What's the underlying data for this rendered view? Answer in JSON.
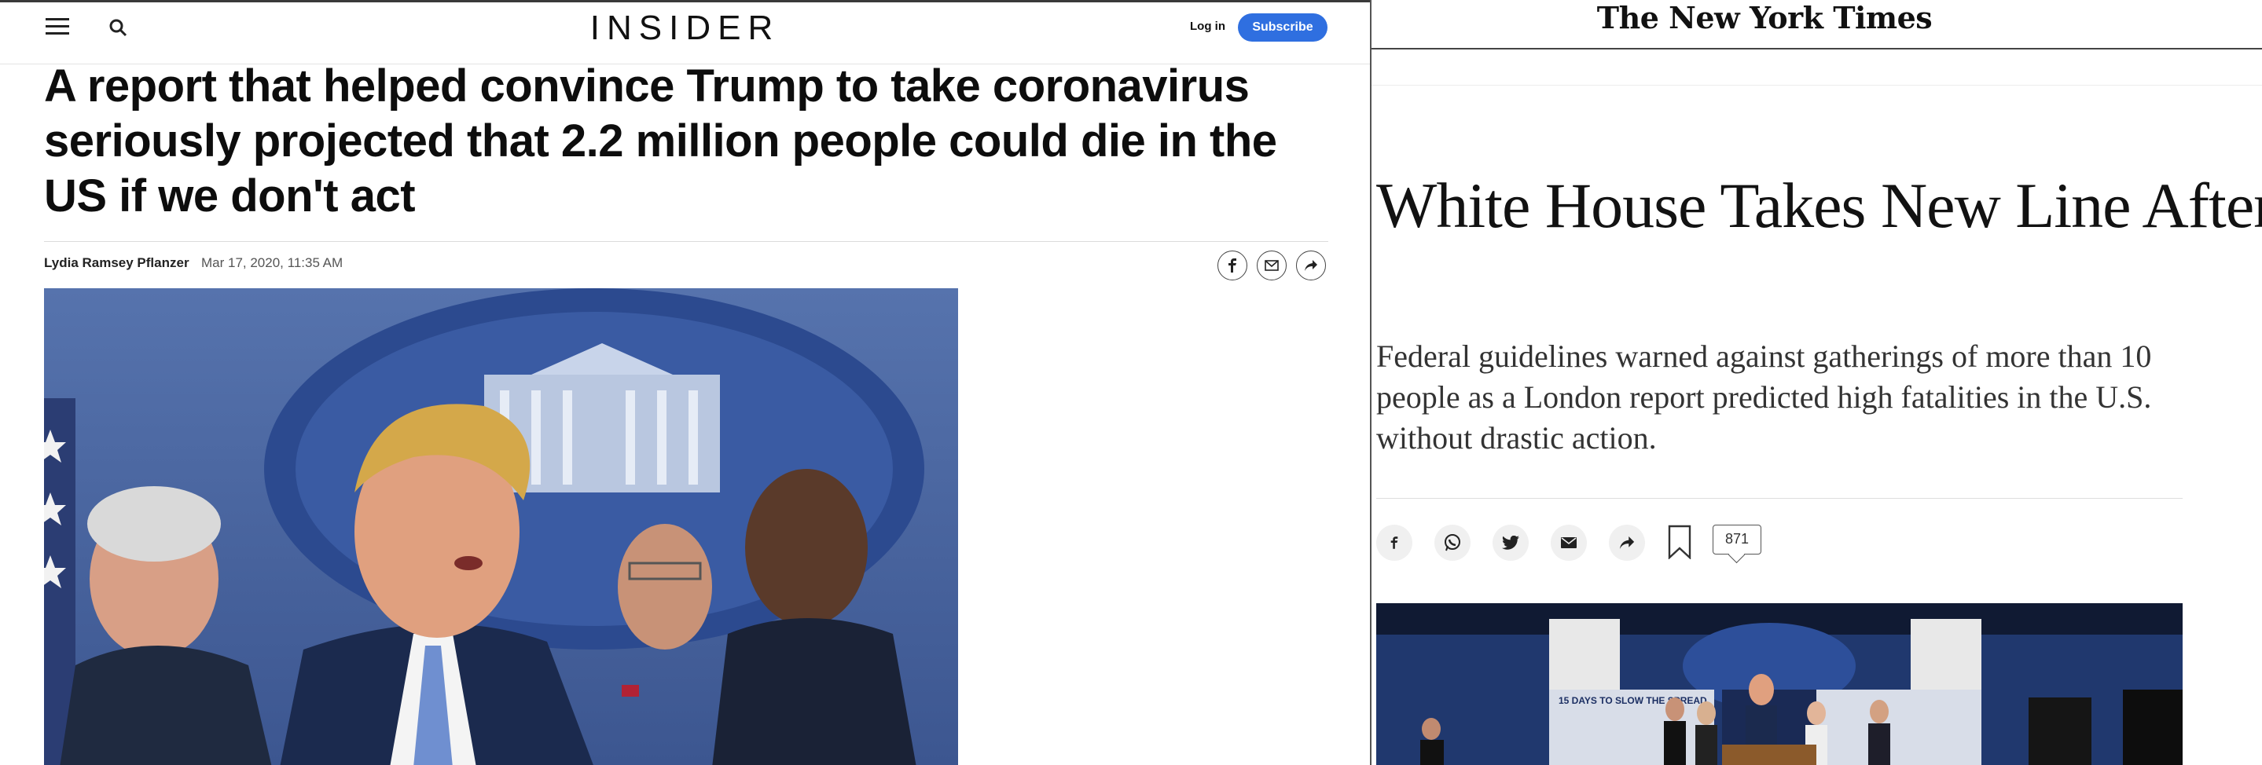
{
  "insider": {
    "logo": "INSIDER",
    "login_label": "Log in",
    "subscribe_label": "Subscribe",
    "headline": "A report that helped convince Trump to take coronavirus seriously projected that 2.2 million people could die in the US if we don't act",
    "author": "Lydia Ramsey Pflanzer",
    "date": "Mar 17, 2020, 11:35 AM",
    "icons": [
      "menu-icon",
      "search-icon",
      "facebook-icon",
      "email-icon",
      "share-icon"
    ]
  },
  "nyt": {
    "logo": "The New York Times",
    "headline": "White House Takes New Line After Dire Report on Death Toll",
    "summary": "Federal guidelines warned against gatherings of more than 10 people as a London report predicted high fatalities in the U.S. without drastic action.",
    "comment_count": "871",
    "photo_sign_text": "15 DAYS TO SLOW THE SPREAD",
    "icons": [
      "facebook-icon",
      "whatsapp-icon",
      "twitter-icon",
      "email-icon",
      "share-icon",
      "bookmark-icon",
      "comment-icon"
    ]
  },
  "colors": {
    "insider_accent": "#2f6fe0",
    "nyt_text": "#121212",
    "press_room_blue": "#2c4a8f"
  }
}
